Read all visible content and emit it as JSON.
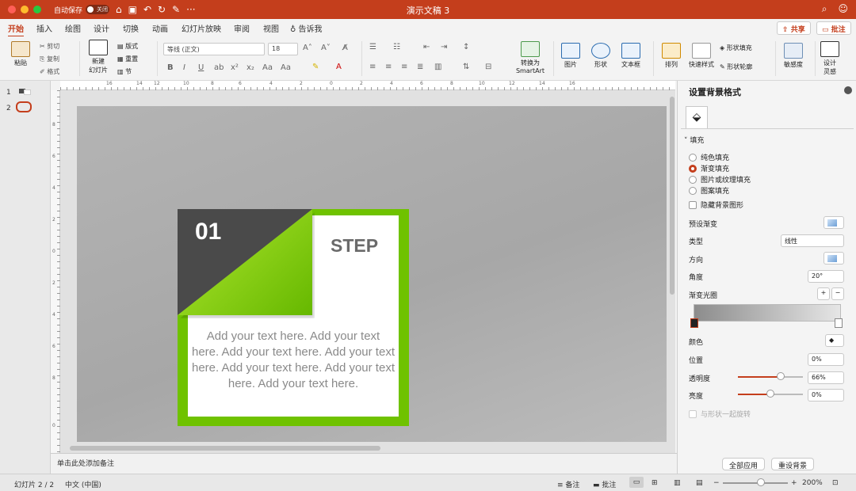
{
  "titlebar": {
    "autosave_label": "自动保存",
    "autosave_state": "关闭",
    "title": "演示文稿 3"
  },
  "tabs": [
    {
      "label": "开始",
      "active": true
    },
    {
      "label": "插入"
    },
    {
      "label": "绘图"
    },
    {
      "label": "设计"
    },
    {
      "label": "切换"
    },
    {
      "label": "动画"
    },
    {
      "label": "幻灯片放映"
    },
    {
      "label": "审阅"
    },
    {
      "label": "视图"
    },
    {
      "label": "告诉我"
    }
  ],
  "share": {
    "share_label": "共享",
    "comment_label": "批注"
  },
  "ribbon": {
    "paste": "粘贴",
    "cut": "剪切",
    "copy": "复制",
    "format": "格式",
    "new_slide_1": "新建",
    "new_slide_2": "幻灯片",
    "layout": "版式",
    "reset": "重置",
    "section": "节",
    "font_name": "等线 (正文)",
    "font_size": "18",
    "smartart_1": "转换为",
    "smartart_2": "SmartArt",
    "picture": "图片",
    "shape": "形状",
    "textbox": "文本框",
    "arrange": "排列",
    "quick_styles": "快速样式",
    "shape_fill": "形状填充",
    "shape_outline": "形状轮廓",
    "sensitivity": "敏感度",
    "designer_1": "设计",
    "designer_2": "灵感"
  },
  "thumbnails": [
    "1",
    "2"
  ],
  "slide": {
    "number": "01",
    "step": "STEP",
    "body": "Add your text here. Add your text here. Add your text here. Add your text here. Add your text here. Add your text here. Add your text here."
  },
  "notes_placeholder": "单击此处添加备注",
  "format_pane": {
    "title": "设置背景格式",
    "section": "填充",
    "fill_options": [
      {
        "label": "纯色填充",
        "selected": false
      },
      {
        "label": "渐变填充",
        "selected": true
      },
      {
        "label": "图片或纹理填充",
        "selected": false
      },
      {
        "label": "图案填充",
        "selected": false
      }
    ],
    "hide_graphics": "隐藏背景图形",
    "preset_label": "预设渐变",
    "type_label": "类型",
    "type_value": "线性",
    "direction_label": "方向",
    "angle_label": "角度",
    "angle_value": "20°",
    "stops_label": "渐变光圈",
    "color_label": "颜色",
    "position_label": "位置",
    "position_value": "0%",
    "transparency_label": "透明度",
    "transparency_value": "66%",
    "transparency_level": 0.66,
    "brightness_label": "亮度",
    "brightness_value": "0%",
    "brightness_level": 0.5,
    "rotate_with_shape": "与形状一起旋转",
    "apply_all": "全部应用",
    "reset_bg": "重设背景"
  },
  "status": {
    "slide_info": "幻灯片 2 / 2",
    "language": "中文 (中国)",
    "notes": "备注",
    "comments": "批注",
    "zoom": "200%"
  },
  "colors": {
    "accent": "#c43e1c",
    "card_green": "#6fc200",
    "dark_block": "#4a4a4a"
  }
}
